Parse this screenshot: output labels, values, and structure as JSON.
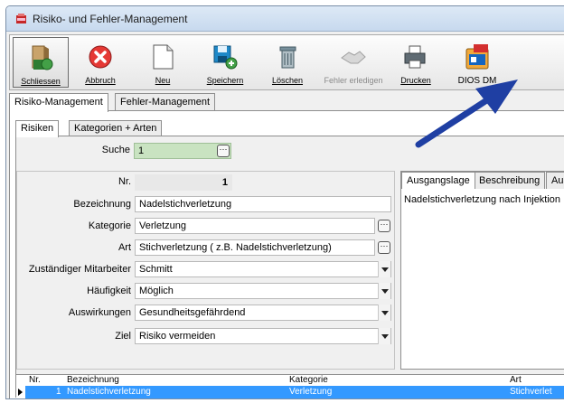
{
  "window": {
    "title": "Risiko- und Fehler-Management"
  },
  "toolbar": {
    "buttons": [
      {
        "label": "Schliessen",
        "icon": "exit-door-icon"
      },
      {
        "label": "Abbruch",
        "icon": "cancel-x-icon"
      },
      {
        "label": "Neu",
        "icon": "new-document-icon"
      },
      {
        "label": "Speichern",
        "icon": "save-disk-icon"
      },
      {
        "label": "Löschen",
        "icon": "trash-icon"
      },
      {
        "label": "Fehler erledigen",
        "icon": "handshake-icon",
        "disabled": true
      },
      {
        "label": "Drucken",
        "icon": "printer-icon"
      },
      {
        "label": "DIOS DM",
        "icon": "dios-dm-pdf-icon"
      }
    ]
  },
  "main_tabs": [
    "Risiko-Management",
    "Fehler-Management"
  ],
  "sub_tabs": [
    "Risiken",
    "Kategorien + Arten"
  ],
  "search": {
    "label": "Suche",
    "value": "1"
  },
  "form": {
    "nr": {
      "label": "Nr.",
      "value": "1"
    },
    "bezeichnung": {
      "label": "Bezeichnung",
      "value": "Nadelstichverletzung"
    },
    "kategorie": {
      "label": "Kategorie",
      "value": "Verletzung"
    },
    "art": {
      "label": "Art",
      "value": "Stichverletzung ( z.B. Nadelstichverletzung)"
    },
    "mitarbeiter": {
      "label": "Zuständiger Mitarbeiter",
      "value": "Schmitt"
    },
    "haeufigkeit": {
      "label": "Häufigkeit",
      "value": "Möglich"
    },
    "auswirkungen": {
      "label": "Auswirkungen",
      "value": "Gesundheitsgefährdend"
    },
    "ziel": {
      "label": "Ziel",
      "value": "Risiko vermeiden"
    }
  },
  "detail_tabs": [
    "Ausgangslage",
    "Beschreibung",
    "Auswir"
  ],
  "detail_text": "Nadelstichverletzung nach Injektion",
  "grid": {
    "headers": [
      "Nr.",
      "Bezeichnung",
      "Kategorie",
      "Art"
    ],
    "rows": [
      {
        "nr": "1",
        "bezeichnung": "Nadelstichverletzung",
        "kategorie": "Verletzung",
        "art": "Stichverlet"
      }
    ]
  },
  "colors": {
    "selection": "#3399ff",
    "search_field": "#c9e3c1",
    "arrow": "#1f3fa3"
  }
}
